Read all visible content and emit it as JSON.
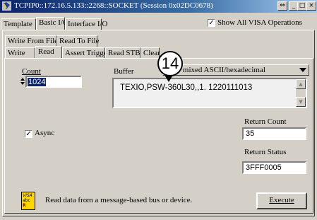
{
  "window": {
    "title": "TCPIP0::172.16.5.133::2268::SOCKET (Session 0x02DC0678)",
    "minimize_glyph": "_",
    "maximize_glyph": "□",
    "close_glyph": "×",
    "restore_glyph": "⇔"
  },
  "main_tabs": [
    "Template",
    "Basic I/O",
    "Interface I/O"
  ],
  "show_all_visa": {
    "label": "Show All VISA Operations",
    "checked": true
  },
  "sub_tabs_row1": [
    "Write From File",
    "Read To File"
  ],
  "sub_tabs_row2": [
    "Write",
    "Read",
    "Assert Trigger",
    "Read STB",
    "Clear"
  ],
  "count": {
    "label": "Count",
    "value": "1024"
  },
  "buffer": {
    "label": "Buffer",
    "mode": "View mixed ASCII/hexadecimal",
    "content": "TEXIO,PSW-360L30,,1. 1220111013"
  },
  "callout": "14",
  "return_count": {
    "label": "Return Count",
    "value": "35"
  },
  "return_status": {
    "label": "Return Status",
    "value": "3FFF0005"
  },
  "async": {
    "label": "Async",
    "checked": true
  },
  "status_message": "Read data from a message-based bus or device.",
  "visa_icon_text": [
    "VISA",
    "abc",
    "R"
  ],
  "execute_label": "Execute"
}
